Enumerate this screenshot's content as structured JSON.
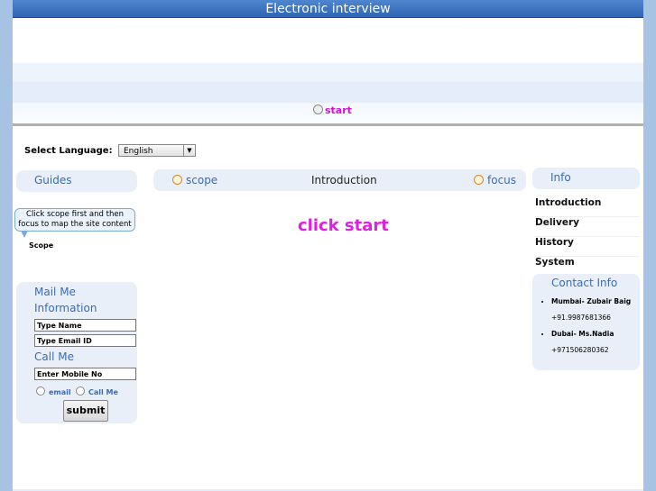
{
  "header": {
    "title": "Electronic interview"
  },
  "banner": {
    "start_label": "start"
  },
  "language": {
    "label": "Select Language:",
    "selected": "English"
  },
  "guides": {
    "title": "Guides",
    "tip": "Click scope first and then focus to map the site content",
    "scope_label": "Scope"
  },
  "nav": {
    "scope": "scope",
    "center": "Introduction",
    "focus": "focus"
  },
  "main": {
    "prompt": "click start"
  },
  "info": {
    "title": "Info",
    "items": [
      "Introduction",
      "Delivery",
      "History",
      "System"
    ]
  },
  "contact": {
    "title": "Contact Info",
    "entries": [
      {
        "name": "Mumbai- Zubair Baig",
        "phone": "+91.9987681366"
      },
      {
        "name": "Dubai- Ms.Nadia",
        "phone": "+971506280362"
      }
    ]
  },
  "form": {
    "mail_title": "Mail Me",
    "info_title": "Information",
    "name_placeholder": "Type Name",
    "email_placeholder": "Type Email ID",
    "call_title": "Call Me",
    "mobile_placeholder": "Enter Mobile No",
    "radio_email": "email",
    "radio_call": "Call Me",
    "submit": "submit"
  }
}
